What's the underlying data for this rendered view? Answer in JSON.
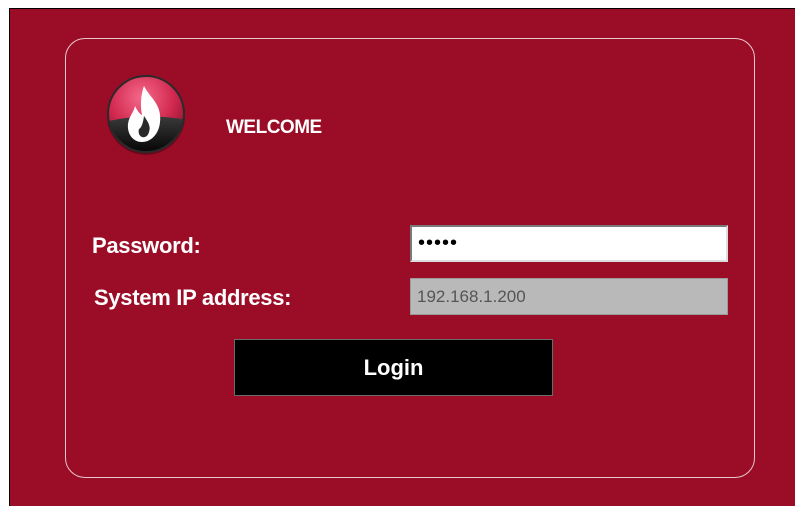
{
  "colors": {
    "background": "#9b0d27",
    "panel_border": "#e9c6cc",
    "button_background": "#000000",
    "text": "#ffffff"
  },
  "header": {
    "logo_icon": "flame-logo-icon",
    "welcome_text": "WELCOME"
  },
  "form": {
    "password_label": "Password:",
    "password_value": "•••••",
    "ip_label": "System IP address:",
    "ip_value": "192.168.1.200",
    "login_label": "Login"
  }
}
